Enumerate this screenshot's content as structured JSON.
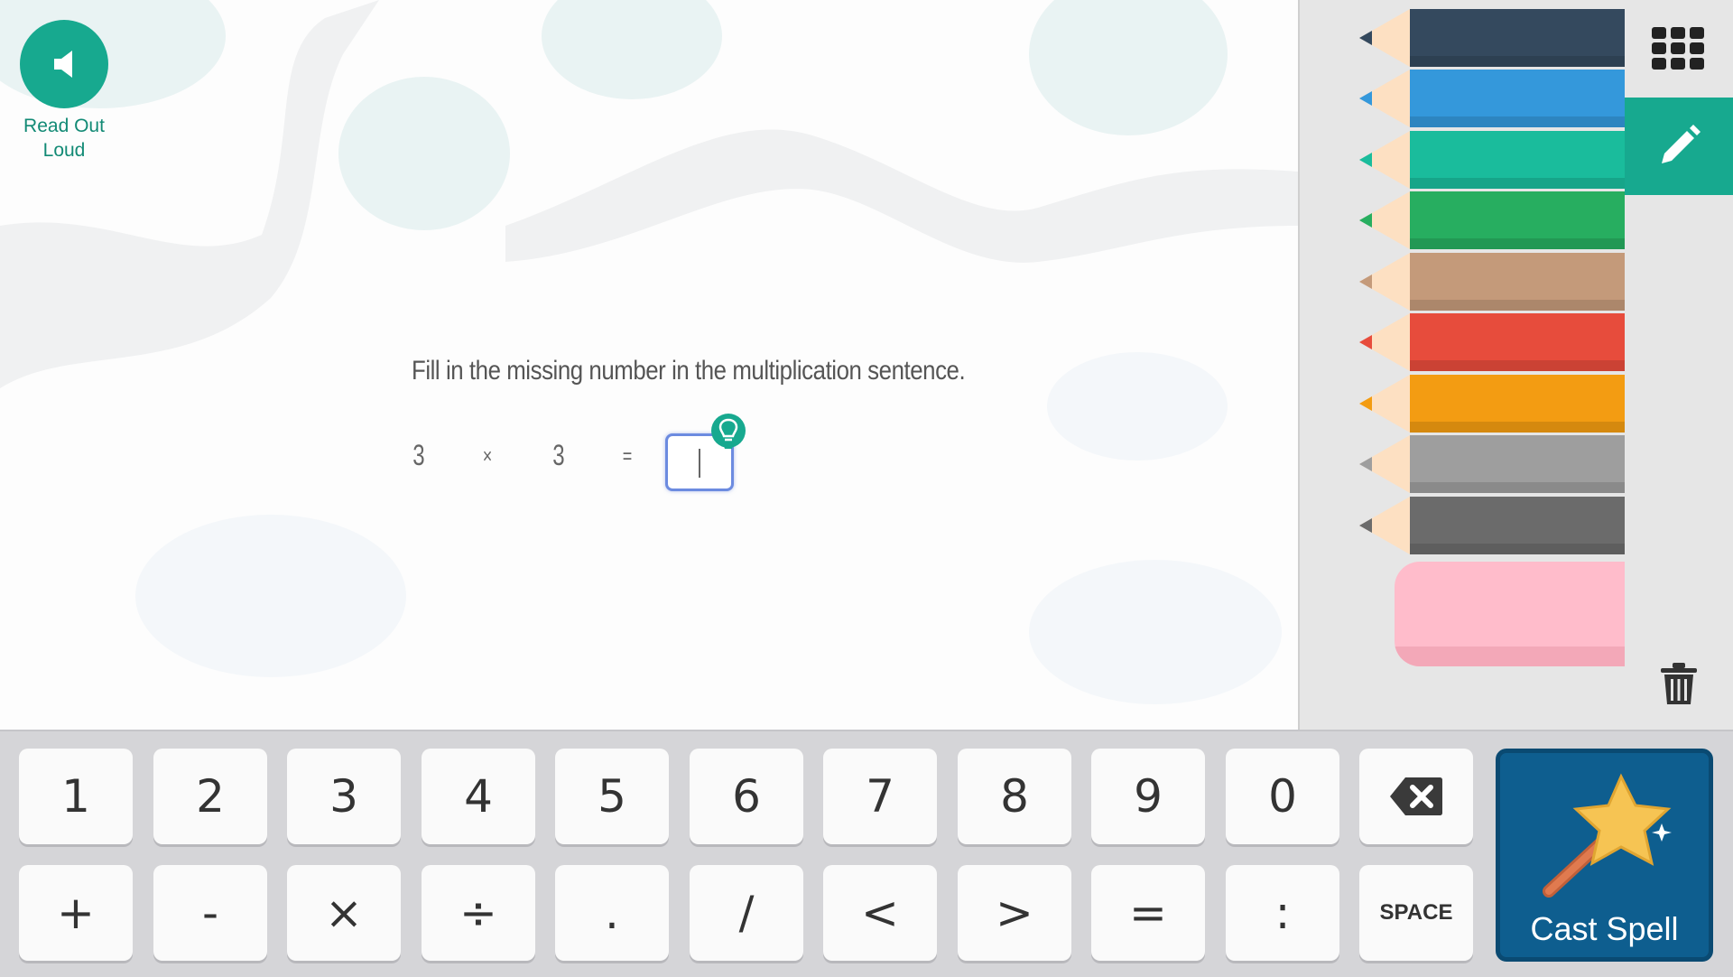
{
  "read_out_loud": {
    "label": "Read Out Loud",
    "icon": "speaker-icon"
  },
  "question": {
    "prompt": "Fill in the missing number in the multiplication sentence.",
    "equation": {
      "left": "3",
      "operator": "×",
      "right": "3",
      "equals": "=",
      "answer_value": ""
    }
  },
  "drawing_panel": {
    "pencils": [
      {
        "name": "dark-navy",
        "color": "#34495e"
      },
      {
        "name": "blue",
        "color": "#3498db"
      },
      {
        "name": "teal",
        "color": "#1abc9c"
      },
      {
        "name": "green",
        "color": "#27ae60"
      },
      {
        "name": "tan",
        "color": "#c49a7a"
      },
      {
        "name": "red",
        "color": "#e74c3c"
      },
      {
        "name": "orange",
        "color": "#f39c12"
      },
      {
        "name": "light-gray",
        "color": "#9e9e9e"
      },
      {
        "name": "dark-gray",
        "color": "#6b6b6b"
      }
    ],
    "eraser_color": "#ffbccb",
    "tools": {
      "grid": "grid-icon",
      "pencil": "pencil-icon",
      "trash": "trash-icon"
    }
  },
  "keypad": {
    "row1": [
      "1",
      "2",
      "3",
      "4",
      "5",
      "6",
      "7",
      "8",
      "9",
      "0",
      "⌫"
    ],
    "row2": [
      "+",
      "-",
      "×",
      "÷",
      ".",
      "/",
      "<",
      ">",
      "=",
      ":",
      "SPACE"
    ],
    "cast_spell": "Cast Spell"
  },
  "colors": {
    "accent": "#17a98f",
    "cast_bg": "#0e5e8f"
  }
}
